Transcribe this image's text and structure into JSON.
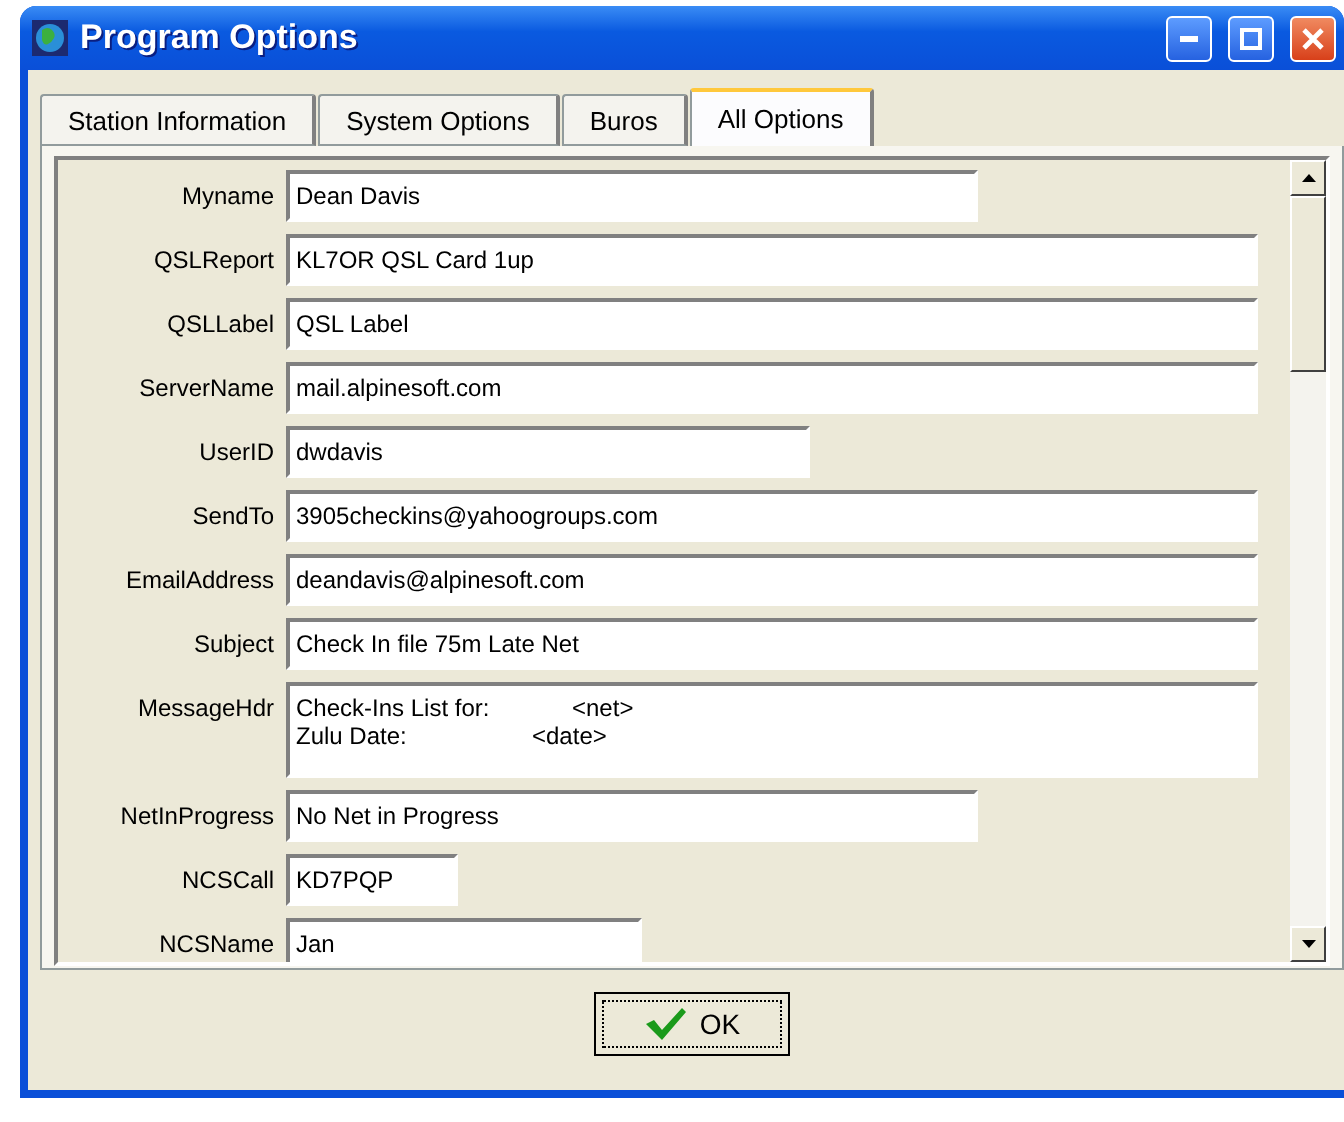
{
  "window": {
    "title": "Program Options"
  },
  "tabs": [
    {
      "label": "Station Information",
      "selected": false
    },
    {
      "label": "System Options",
      "selected": false
    },
    {
      "label": "Buros",
      "selected": false
    },
    {
      "label": "All Options",
      "selected": true
    }
  ],
  "fields": [
    {
      "label": "Myname",
      "kind": "long",
      "value": "Dean Davis"
    },
    {
      "label": "QSLReport",
      "kind": "full",
      "value": "KL7OR QSL Card 1up"
    },
    {
      "label": "QSLLabel",
      "kind": "full",
      "value": "QSL Label"
    },
    {
      "label": "ServerName",
      "kind": "full",
      "value": "mail.alpinesoft.com"
    },
    {
      "label": "UserID",
      "kind": "medium",
      "value": "dwdavis"
    },
    {
      "label": "SendTo",
      "kind": "full",
      "value": "3905checkins@yahoogroups.com"
    },
    {
      "label": "EmailAddress",
      "kind": "full",
      "value": "deandavis@alpinesoft.com"
    },
    {
      "label": "Subject",
      "kind": "full",
      "value": "Check In file 75m Late Net"
    },
    {
      "label": "MessageHdr",
      "kind": "memo",
      "lines": [
        {
          "name": "Check-Ins List for:",
          "tag": "<net>"
        },
        {
          "name": "Zulu Date:",
          "tag": "<date>"
        }
      ]
    },
    {
      "label": "NetInProgress",
      "kind": "long",
      "value": "No Net in Progress"
    },
    {
      "label": "NCSCall",
      "kind": "tiny",
      "value": "KD7PQP"
    },
    {
      "label": "NCSName",
      "kind": "short",
      "value": "Jan"
    }
  ],
  "ok_button": {
    "label": "OK"
  }
}
